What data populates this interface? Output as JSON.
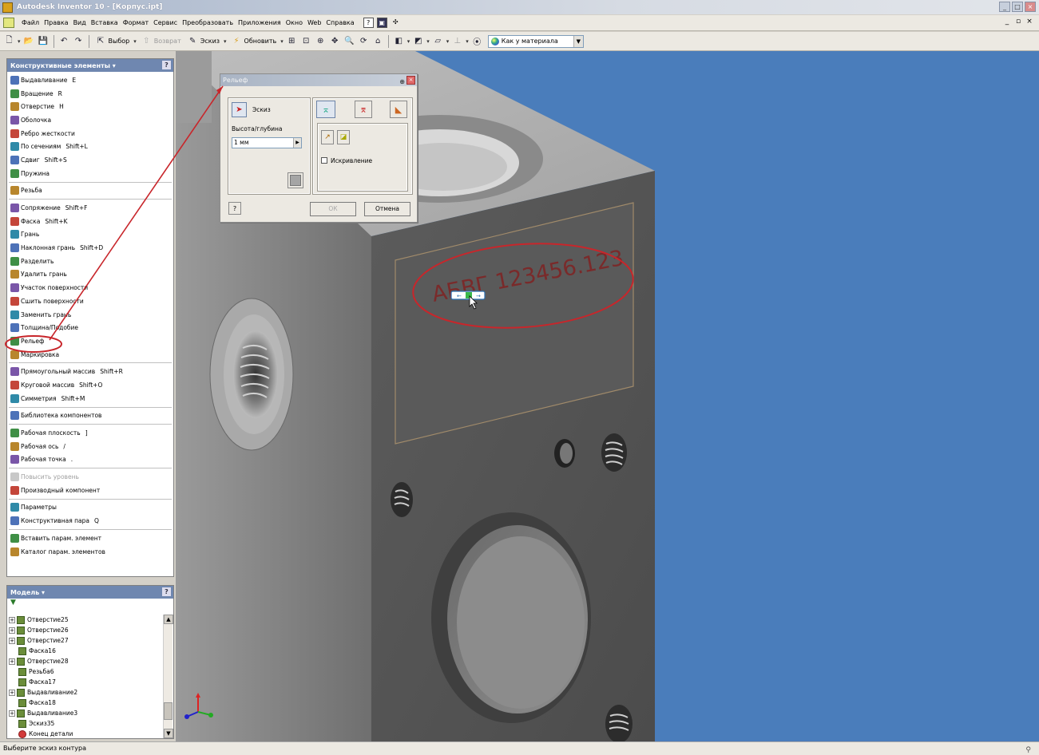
{
  "window": {
    "title": "Autodesk Inventor 10 - [Корпус.ipt]",
    "min": "_",
    "max": "□",
    "close": "×"
  },
  "menu": {
    "items": [
      "Файл",
      "Правка",
      "Вид",
      "Вставка",
      "Формат",
      "Сервис",
      "Преобразовать",
      "Приложения",
      "Окно",
      "Web",
      "Справка"
    ],
    "mdi": [
      "_",
      "▫",
      "×"
    ]
  },
  "toolbar": {
    "select_label": "Выбор",
    "return_label": "Возврат",
    "sketch_label": "Эскиз",
    "update_label": "Обновить",
    "material": "Как у материала"
  },
  "features_panel": {
    "title": "Конструктивные элементы ▾",
    "help": "?",
    "groups": [
      [
        {
          "label": "Выдавливание",
          "hotkey": "E"
        },
        {
          "label": "Вращение",
          "hotkey": "R"
        },
        {
          "label": "Отверстие",
          "hotkey": "H"
        },
        {
          "label": "Оболочка",
          "hotkey": ""
        },
        {
          "label": "Ребро жесткости",
          "hotkey": ""
        },
        {
          "label": "По сечениям",
          "hotkey": "Shift+L"
        },
        {
          "label": "Сдвиг",
          "hotkey": "Shift+S"
        },
        {
          "label": "Пружина",
          "hotkey": ""
        }
      ],
      [
        {
          "label": "Резьба",
          "hotkey": ""
        }
      ],
      [
        {
          "label": "Сопряжение",
          "hotkey": "Shift+F"
        },
        {
          "label": "Фаска",
          "hotkey": "Shift+K"
        },
        {
          "label": "Грань",
          "hotkey": ""
        },
        {
          "label": "Наклонная грань",
          "hotkey": "Shift+D"
        },
        {
          "label": "Разделить",
          "hotkey": ""
        },
        {
          "label": "Удалить грань",
          "hotkey": ""
        },
        {
          "label": "Участок поверхности",
          "hotkey": ""
        },
        {
          "label": "Сшить поверхности",
          "hotkey": ""
        },
        {
          "label": "Заменить грань",
          "hotkey": ""
        },
        {
          "label": "Толщина/Подобие",
          "hotkey": ""
        },
        {
          "label": "Рельеф",
          "hotkey": ""
        },
        {
          "label": "Маркировка",
          "hotkey": ""
        }
      ],
      [
        {
          "label": "Прямоугольный массив",
          "hotkey": "Shift+R"
        },
        {
          "label": "Круговой массив",
          "hotkey": "Shift+O"
        },
        {
          "label": "Симметрия",
          "hotkey": "Shift+M"
        }
      ],
      [
        {
          "label": "Библиотека компонентов",
          "hotkey": ""
        }
      ],
      [
        {
          "label": "Рабочая плоскость",
          "hotkey": "]"
        },
        {
          "label": "Рабочая ось",
          "hotkey": "/"
        },
        {
          "label": "Рабочая точка",
          "hotkey": "."
        }
      ],
      [
        {
          "label": "Повысить уровень",
          "hotkey": "",
          "disabled": true
        },
        {
          "label": "Производный компонент",
          "hotkey": ""
        }
      ],
      [
        {
          "label": "Параметры",
          "hotkey": ""
        },
        {
          "label": "Конструктивная пара",
          "hotkey": "Q"
        }
      ],
      [
        {
          "label": "Вставить парам. элемент",
          "hotkey": ""
        },
        {
          "label": "Каталог парам. элементов",
          "hotkey": ""
        }
      ]
    ]
  },
  "model_panel": {
    "title": "Модель ▾",
    "help": "?",
    "tree": [
      {
        "label": "Отверстие25",
        "indent": false
      },
      {
        "label": "Отверстие26",
        "indent": false
      },
      {
        "label": "Отверстие27",
        "indent": false
      },
      {
        "label": "Фаска16",
        "indent": true
      },
      {
        "label": "Отверстие28",
        "indent": false
      },
      {
        "label": "Резьба6",
        "indent": true
      },
      {
        "label": "Фаска17",
        "indent": true
      },
      {
        "label": "Выдавливание2",
        "indent": false
      },
      {
        "label": "Фаска18",
        "indent": true
      },
      {
        "label": "Выдавливание3",
        "indent": false
      },
      {
        "label": "Эскиз35",
        "indent": true
      },
      {
        "label": "Конец детали",
        "indent": true,
        "end": true
      }
    ]
  },
  "dialog": {
    "title": "Рельеф",
    "sketch_label": "Эскиз",
    "depth_label": "Высота/глубина",
    "depth_value": "1 мм",
    "distortion_label": "Искривление",
    "ok_label": "ОК",
    "cancel_label": "Отмена",
    "help": "?"
  },
  "viewport": {
    "emboss_text": "АБВГ 123456.123"
  },
  "status": {
    "text": "Выберите эскиз контура"
  },
  "colors": {
    "viewport_bg": "#4a7dbb",
    "highlight_red": "#c8262b"
  }
}
